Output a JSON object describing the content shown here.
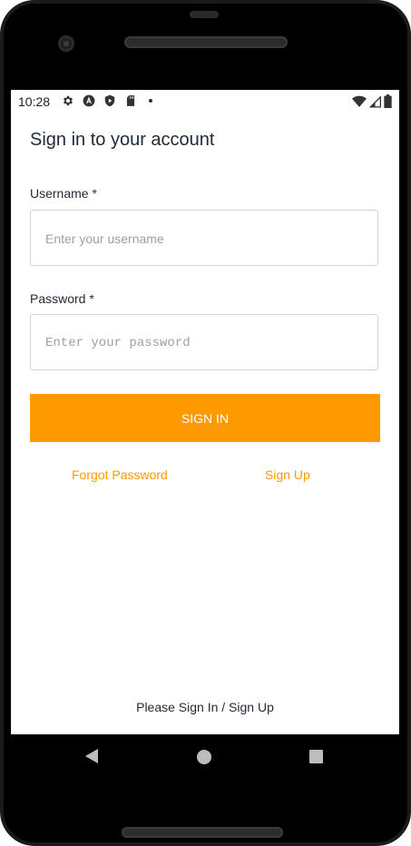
{
  "status_bar": {
    "time": "10:28",
    "left_icons": [
      "gear-icon",
      "android-a-icon",
      "shield-play-icon",
      "sd-card-icon",
      "dot-icon"
    ],
    "right_icons": [
      "wifi-icon",
      "signal-icon",
      "battery-icon"
    ]
  },
  "form": {
    "title": "Sign in to your account",
    "username_label": "Username *",
    "username_placeholder": "Enter your username",
    "password_label": "Password *",
    "password_placeholder": "Enter your password",
    "signin_label": "SIGN IN",
    "forgot_password": "Forgot Password",
    "sign_up": "Sign Up"
  },
  "footer": {
    "text": "Please Sign In / Sign Up"
  },
  "colors": {
    "accent": "#ff9900",
    "text": "#1f2a36",
    "border": "#cfd4da"
  },
  "nav_bar": [
    "back-icon",
    "home-icon",
    "recents-icon"
  ]
}
